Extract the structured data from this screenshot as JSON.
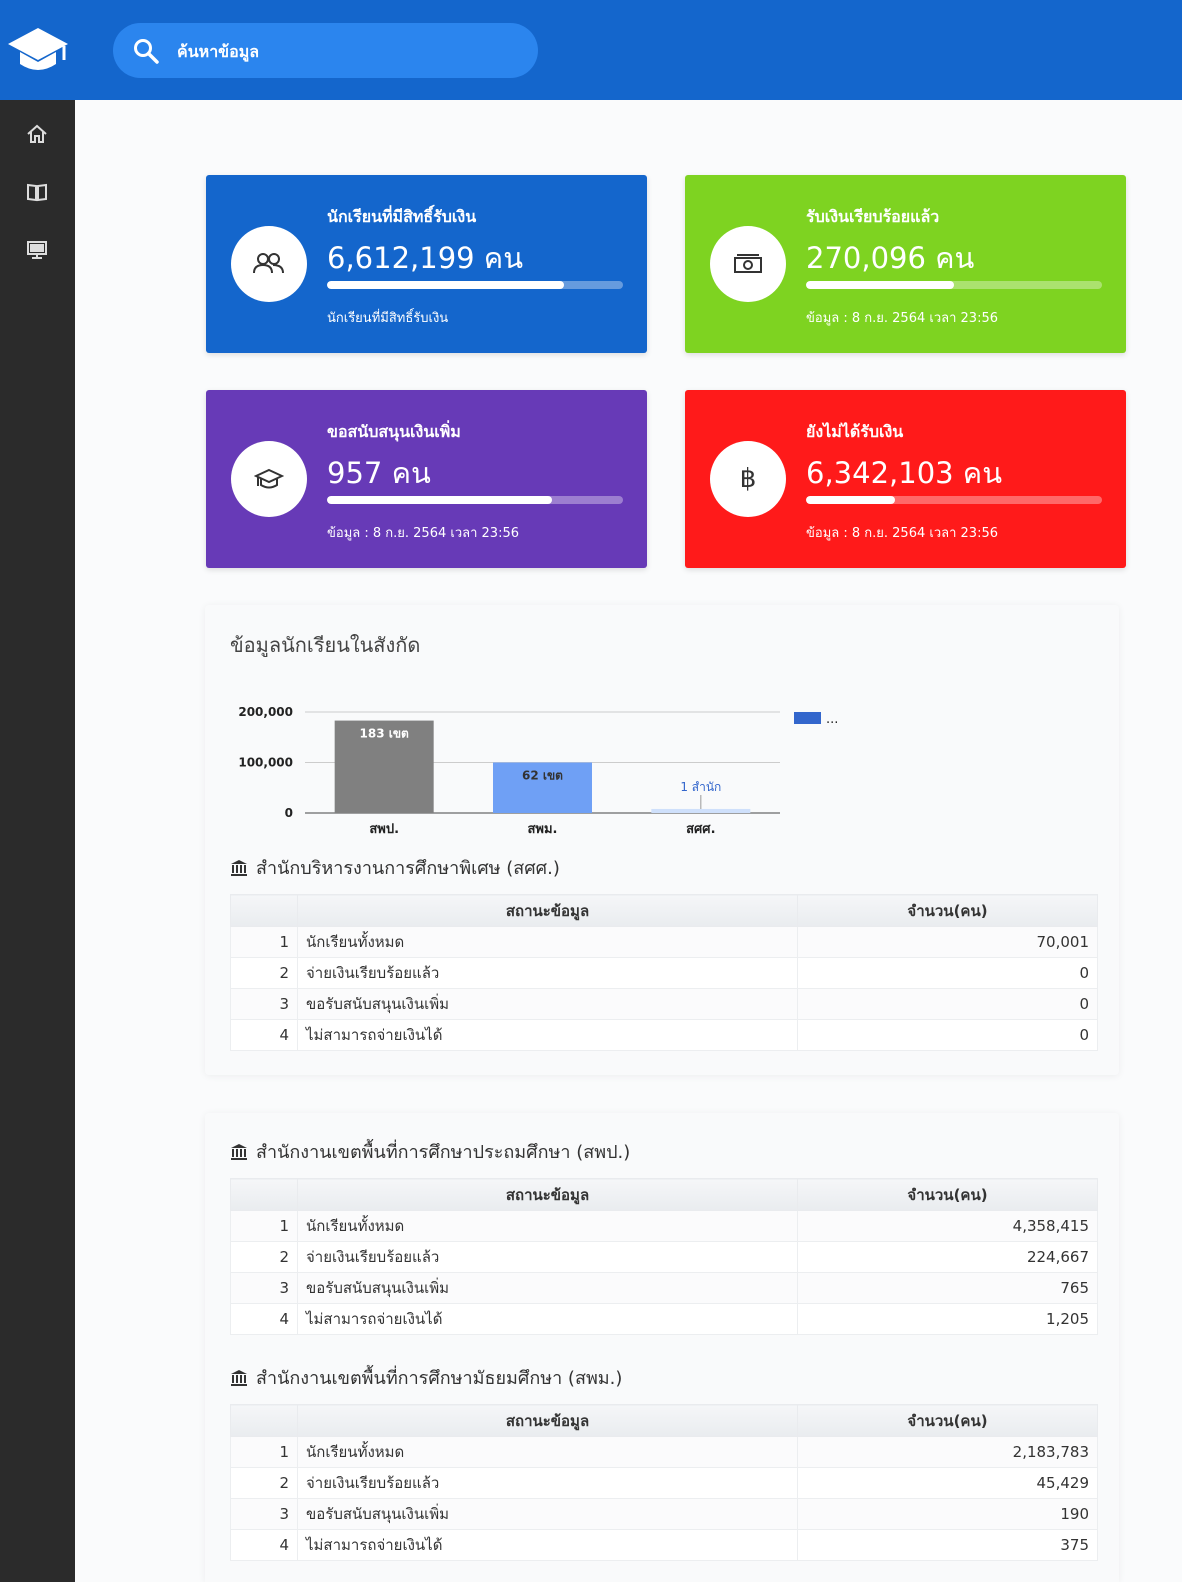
{
  "search": {
    "placeholder": "ค้นหาข้อมูล"
  },
  "sidebar": {
    "items": [
      "home-icon",
      "book-icon",
      "monitor-icon"
    ]
  },
  "cards": [
    {
      "title": "นักเรียนที่มีสิทธิ์รับเงิน",
      "value": "6,612,199 คน",
      "progress": 0.8,
      "footer": "นักเรียนที่มีสิทธิ์รับเงิน",
      "color": "#1466cc",
      "icon": "users-icon"
    },
    {
      "title": "รับเงินเรียบร้อยแล้ว",
      "value": "270,096 คน",
      "progress": 0.5,
      "footer": "ข้อมูล : 8 ก.ย. 2564 เวลา 23:56",
      "color": "#7ed321",
      "icon": "money-icon"
    },
    {
      "title": "ขอสนับสนุนเงินเพิ่ม",
      "value": "957 คน",
      "progress": 0.76,
      "footer": "ข้อมูล : 8 ก.ย. 2564 เวลา 23:56",
      "color": "#673ab7",
      "icon": "graduation-cap-icon"
    },
    {
      "title": "ยังไม่ได้รับเงิน",
      "value": "6,342,103 คน",
      "progress": 0.3,
      "footer": "ข้อมูล : 8 ก.ย. 2564 เวลา 23:56",
      "color": "#ff1a1a",
      "icon": "baht-icon"
    }
  ],
  "panel1": {
    "title": "ข้อมูลนักเรียนในสังกัด"
  },
  "chart_data": {
    "type": "bar",
    "categories": [
      "สพป.",
      "สพม.",
      "สศศ."
    ],
    "values": [
      183,
      62,
      1
    ],
    "bar_values": [
      183000,
      100000,
      8000
    ],
    "data_labels": [
      "183 เขต",
      "62 เขต",
      "1 สำนัก"
    ],
    "bar_colors": [
      "#808080",
      "#6fa0f5",
      "#cfe0fb"
    ],
    "yticks": [
      "200,000",
      "100,000",
      "0"
    ],
    "ylim": [
      0,
      200000
    ],
    "legend": {
      "label": "...",
      "color": "#3366cc",
      "position": "top-right"
    },
    "grid": true
  },
  "tables": [
    {
      "title": "สำนักบริหารงานการศึกษาพิเศษ (สศศ.)",
      "headers": [
        "",
        "สถานะข้อมูล",
        "จำนวน(คน)"
      ],
      "rows": [
        {
          "no": "1",
          "status": "นักเรียนทั้งหมด",
          "count": "70,001"
        },
        {
          "no": "2",
          "status": "จ่ายเงินเรียบร้อยแล้ว",
          "count": "0"
        },
        {
          "no": "3",
          "status": "ขอรับสนับสนุนเงินเพิ่ม",
          "count": "0"
        },
        {
          "no": "4",
          "status": "ไม่สามารถจ่ายเงินได้",
          "count": "0"
        }
      ]
    },
    {
      "title": "สำนักงานเขตพื้นที่การศึกษาประถมศึกษา (สพป.)",
      "headers": [
        "",
        "สถานะข้อมูล",
        "จำนวน(คน)"
      ],
      "rows": [
        {
          "no": "1",
          "status": "นักเรียนทั้งหมด",
          "count": "4,358,415"
        },
        {
          "no": "2",
          "status": "จ่ายเงินเรียบร้อยแล้ว",
          "count": "224,667"
        },
        {
          "no": "3",
          "status": "ขอรับสนับสนุนเงินเพิ่ม",
          "count": "765"
        },
        {
          "no": "4",
          "status": "ไม่สามารถจ่ายเงินได้",
          "count": "1,205"
        }
      ]
    },
    {
      "title": "สำนักงานเขตพื้นที่การศึกษามัธยมศึกษา (สพม.)",
      "headers": [
        "",
        "สถานะข้อมูล",
        "จำนวน(คน)"
      ],
      "rows": [
        {
          "no": "1",
          "status": "นักเรียนทั้งหมด",
          "count": "2,183,783"
        },
        {
          "no": "2",
          "status": "จ่ายเงินเรียบร้อยแล้ว",
          "count": "45,429"
        },
        {
          "no": "3",
          "status": "ขอรับสนับสนุนเงินเพิ่ม",
          "count": "190"
        },
        {
          "no": "4",
          "status": "ไม่สามารถจ่ายเงินได้",
          "count": "375"
        }
      ]
    }
  ]
}
